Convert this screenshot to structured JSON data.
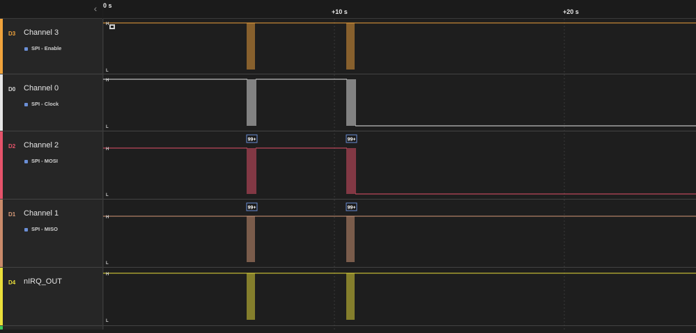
{
  "header": {
    "collapse_icon": "chevron-left-icon",
    "time_labels": [
      "0 s",
      "+10 s",
      "+20 s"
    ]
  },
  "channels": [
    {
      "tag": "D3",
      "name": "Channel 3",
      "analyzer": "SPI - Enable",
      "color": "#f0a33c",
      "high": "H",
      "low": "L",
      "badges": []
    },
    {
      "tag": "D0",
      "name": "Channel 0",
      "analyzer": "SPI - Clock",
      "color": "#e6e6e6",
      "high": "H",
      "low": "L",
      "badges": []
    },
    {
      "tag": "D2",
      "name": "Channel 2",
      "analyzer": "SPI - MOSI",
      "color": "#e5536a",
      "high": "H",
      "low": "L",
      "badges": [
        "99+",
        "99+"
      ]
    },
    {
      "tag": "D1",
      "name": "Channel 1",
      "analyzer": "SPI - MISO",
      "color": "#d69a78",
      "high": "H",
      "low": "L",
      "badges": [
        "99+",
        "99+"
      ]
    },
    {
      "tag": "D4",
      "name": "nIRQ_OUT",
      "analyzer": "",
      "color": "#eadf3a",
      "high": "H",
      "low": "L",
      "badges": []
    }
  ]
}
